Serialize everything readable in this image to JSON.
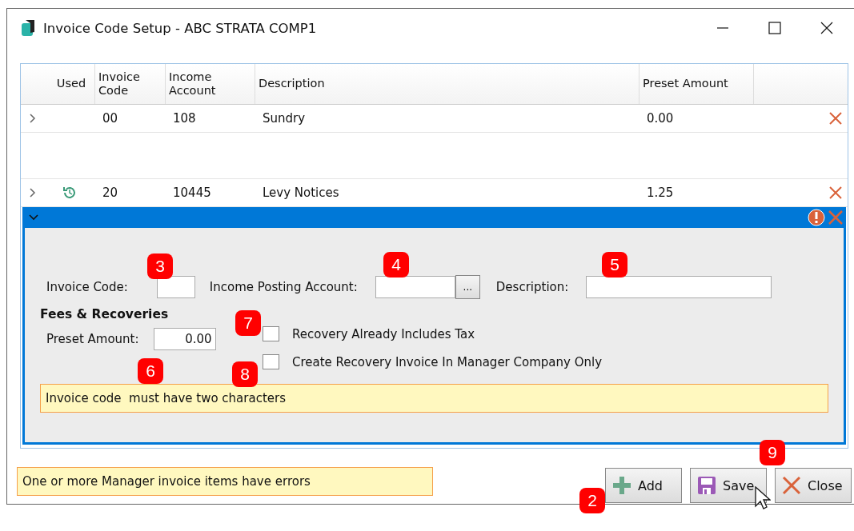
{
  "window": {
    "title": "Invoice Code Setup - ABC STRATA COMP1"
  },
  "table": {
    "columns": [
      "Used",
      "Invoice Code",
      "Income Account",
      "Description",
      "Preset Amount"
    ],
    "rows": [
      {
        "used": false,
        "code": "00",
        "account": "108",
        "description": "Sundry",
        "preset_amount": "0.00"
      },
      {
        "used": true,
        "code": "20",
        "account": "10445",
        "description": "Levy Notices",
        "preset_amount": "1.25"
      }
    ]
  },
  "editor": {
    "expanded": true,
    "invoice_code_label": "Invoice Code:",
    "income_account_label": "Income Posting Account:",
    "browse_button": "...",
    "description_label": "Description:",
    "section_title": "Fees & Recoveries",
    "preset_amount_label": "Preset Amount:",
    "preset_amount_value": "0.00",
    "checkboxes": [
      {
        "label": "Recovery Already Includes Tax",
        "checked": false
      },
      {
        "label": "Create Recovery Invoice In Manager Company Only",
        "checked": false
      }
    ],
    "error_message": "Invoice code  must have two characters"
  },
  "status_message": "One or more Manager invoice items have errors",
  "buttons": [
    {
      "kind": "add",
      "label": "Add"
    },
    {
      "kind": "save",
      "label": "Save"
    },
    {
      "kind": "close",
      "label": "Close"
    }
  ],
  "callouts": [
    "3",
    "4",
    "5",
    "6",
    "7",
    "8",
    "2",
    "9"
  ]
}
